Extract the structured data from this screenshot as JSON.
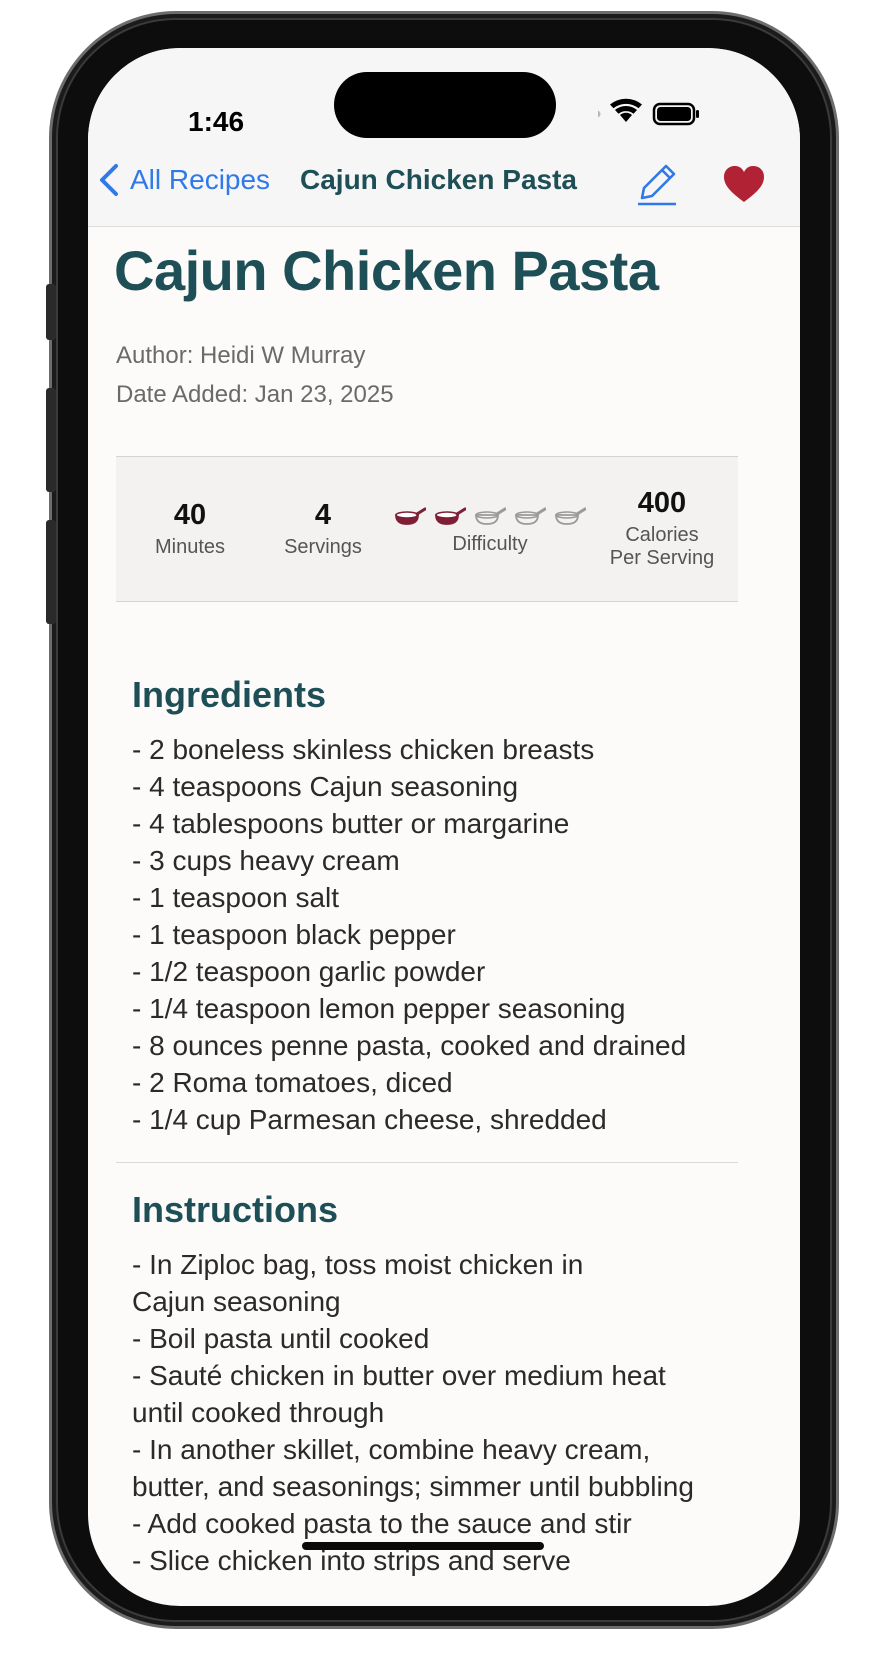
{
  "status_bar": {
    "time": "1:46"
  },
  "nav": {
    "back_label": "All Recipes",
    "title": "Cajun Chicken Pasta"
  },
  "recipe": {
    "title": "Cajun Chicken Pasta",
    "author": "Author: Heidi W Murray",
    "date_added": "Date Added: Jan 23, 2025",
    "stats": {
      "minutes_value": "40",
      "minutes_label": "Minutes",
      "servings_value": "4",
      "servings_label": "Servings",
      "difficulty_label": "Difficulty",
      "difficulty_level": 2,
      "difficulty_max": 5,
      "calories_value": "400",
      "calories_label_1": "Calories",
      "calories_label_2": "Per Serving"
    },
    "ingredients_title": "Ingredients",
    "ingredients": [
      "- 2 boneless skinless chicken breasts",
      "- 4 teaspoons Cajun seasoning",
      "- 4 tablespoons butter or margarine",
      "- 3 cups heavy cream",
      "- 1 teaspoon salt",
      "- 1 teaspoon black pepper",
      "- 1/2 teaspoon garlic powder",
      "- 1/4 teaspoon lemon pepper seasoning",
      "- 8 ounces penne pasta, cooked and drained",
      "- 2 Roma tomatoes, diced",
      "- 1/4 cup Parmesan cheese, shredded"
    ],
    "instructions_title": "Instructions",
    "instructions": [
      "- In Ziploc bag, toss moist chicken in",
      "Cajun seasoning",
      "- Boil pasta until cooked",
      "- Sauté chicken in butter over medium heat",
      "until cooked through",
      "- In another skillet, combine heavy cream,",
      "butter, and seasonings; simmer until bubbling",
      "- Add cooked pasta to the sauce and stir",
      "- Slice chicken into strips and serve"
    ]
  },
  "colors": {
    "accent_blue": "#2f79e8",
    "title_teal": "#1e4f57",
    "favorite_red": "#b02234",
    "pan_filled": "#7e1f35",
    "pan_empty": "#9a9a9a"
  }
}
